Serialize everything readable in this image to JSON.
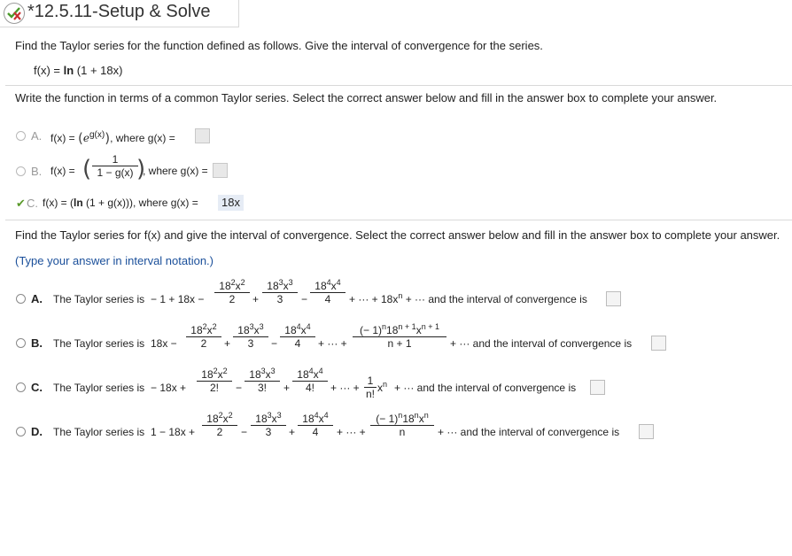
{
  "header": {
    "title": "*12.5.11-Setup & Solve",
    "status_icon": "partial-correct-icon"
  },
  "problem": {
    "prompt": "Find the Taylor series for the function defined as follows. Give the interval of convergence for the series.",
    "function_lhs": "f(x) = ",
    "function_ln": "ln",
    "function_arg": " (1 + 18x)"
  },
  "part1": {
    "instructions": "Write the function in terms of a common Taylor series. Select the correct answer below and fill in the answer box to complete your answer.",
    "options": [
      {
        "letter": "A.",
        "prefix": "f(x) = ",
        "expr": "e",
        "exp": "g(x)",
        "suffix": ", where g(x) = "
      },
      {
        "letter": "B.",
        "prefix": "f(x) = ",
        "num": "1",
        "den": "1 − g(x)",
        "suffix": ", where g(x) = "
      },
      {
        "letter": "C.",
        "prefix": "f(x) = (",
        "ln": "ln",
        "mid": " (1 + g(x))), where g(x) = ",
        "answer": "18x"
      }
    ]
  },
  "part2": {
    "instructions": "Find the Taylor series for f(x) and give the interval of convergence. Select the correct answer below and fill in the answer box to complete your answer.",
    "hint": "(Type your answer in interval notation.)",
    "lead": "The Taylor series is",
    "options": [
      {
        "letter": "A.",
        "start": " − 1 + 18x −",
        "t2n": "18",
        "t2x": "x",
        "t2d": "2",
        "op2": "+",
        "t3n": "18",
        "t3x": "x",
        "t3d": "3",
        "op3": "−",
        "t4n": "18",
        "t4x": "x",
        "t4d": "4",
        "tail": "+ ··· + 18x",
        "tail_sup": "n",
        "end": " + ··· and the interval of convergence is"
      },
      {
        "letter": "B.",
        "start": " 18x −",
        "t2n": "18",
        "t2x": "x",
        "t2d": "2",
        "op2": "+",
        "t3n": "18",
        "t3x": "x",
        "t3d": "3",
        "op3": "−",
        "t4n": "18",
        "t4x": "x",
        "t4d": "4",
        "dots": "+ ··· +",
        "gnum": "(− 1)",
        "gden": "n + 1",
        "end": "+ ··· and the interval of convergence is"
      },
      {
        "letter": "C.",
        "start": " − 18x +",
        "t2n": "18",
        "t2x": "x",
        "t2d": "2!",
        "op2": "−",
        "t3n": "18",
        "t3x": "x",
        "t3d": "3!",
        "op3": "+",
        "t4n": "18",
        "t4x": "x",
        "t4d": "4!",
        "dots": "+ ··· +",
        "gnum": "1",
        "gden": "n!",
        "gx": "x",
        "gx_sup": "n",
        "end": "+ ··· and the interval of convergence is"
      },
      {
        "letter": "D.",
        "start": " 1 − 18x +",
        "t2n": "18",
        "t2x": "x",
        "t2d": "2",
        "op2": "−",
        "t3n": "18",
        "t3x": "x",
        "t3d": "3",
        "op3": "+",
        "t4n": "18",
        "t4x": "x",
        "t4d": "4",
        "dots": "+ ··· +",
        "gnum": "(− 1)",
        "gden": "n",
        "end": "+ ··· and the interval of convergence is"
      }
    ]
  },
  "colors": {
    "check": "#5a9a2a",
    "filled_bg": "#e6ecf5",
    "box_bg": "#e8e8e8"
  }
}
